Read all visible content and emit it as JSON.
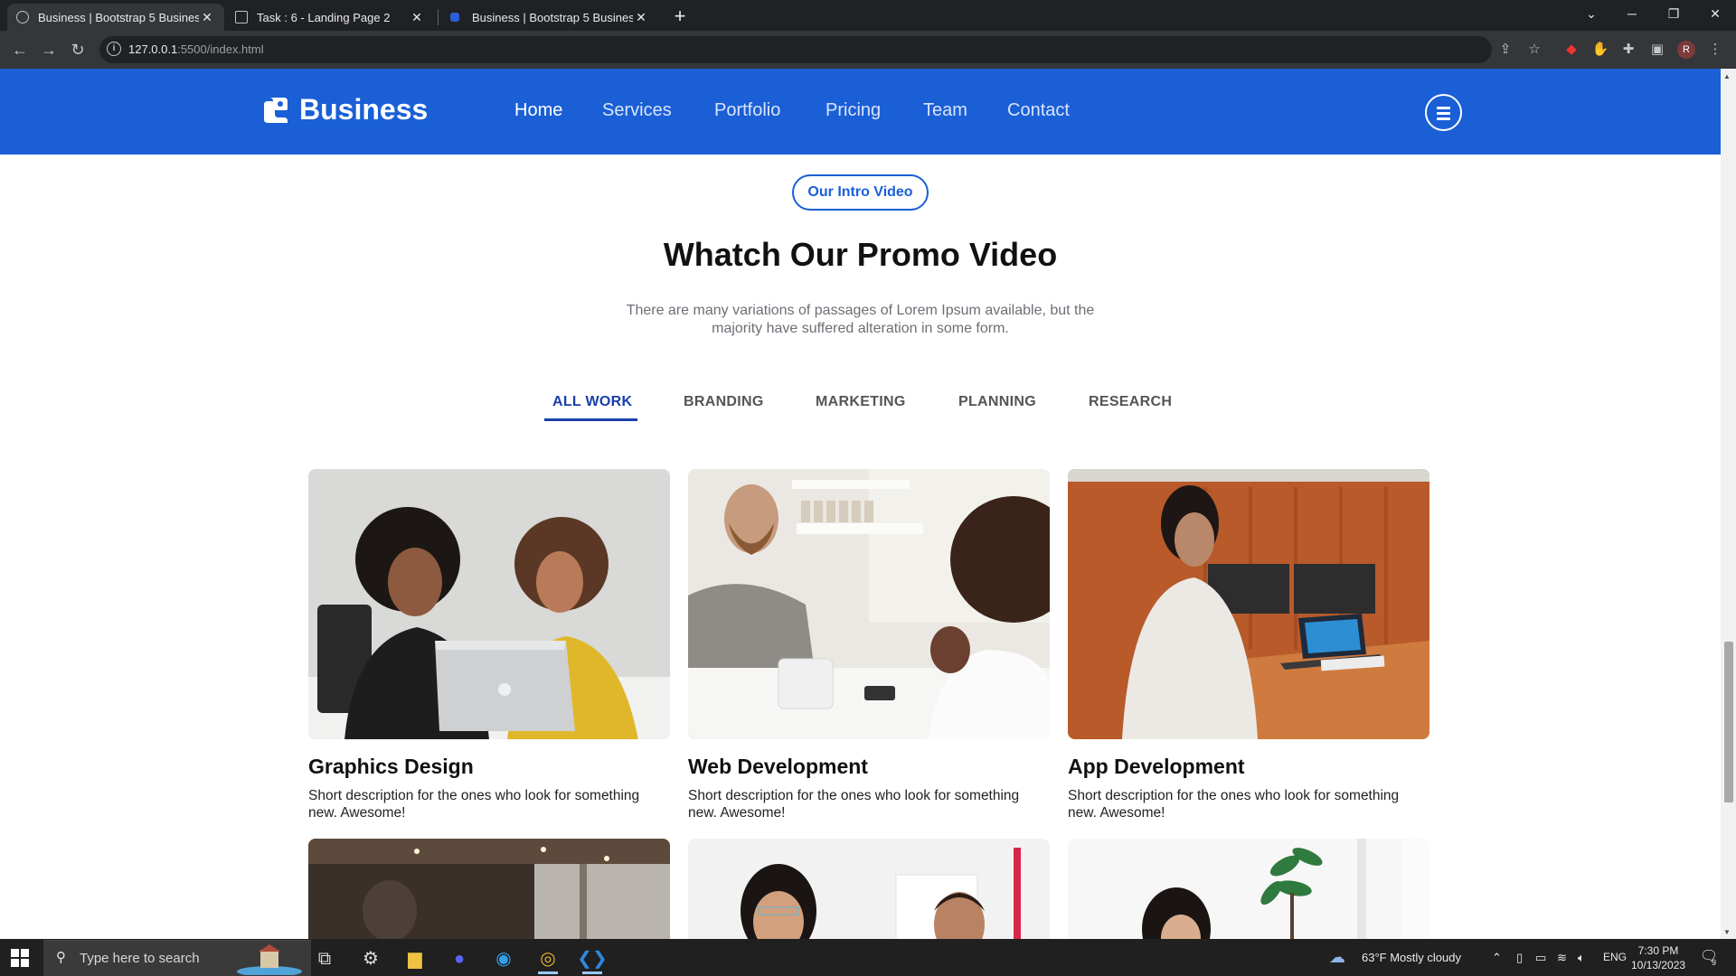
{
  "browser": {
    "tabs": [
      {
        "title": "Business | Bootstrap 5 Business T",
        "active": true
      },
      {
        "title": "Task : 6 - Landing Page 2",
        "active": false
      },
      {
        "title": "Business | Bootstrap 5 Business T",
        "active": false
      }
    ],
    "url_host": "127.0.0.1",
    "url_path": ":5500/index.html",
    "profile_initial": "R"
  },
  "site": {
    "brand": "Business",
    "nav": [
      "Home",
      "Services",
      "Portfolio",
      "Pricing",
      "Team",
      "Contact"
    ],
    "accent_color": "#1a5fd6"
  },
  "section": {
    "badge": "Our Intro Video",
    "heading": "Whatch Our Promo Video",
    "subtext": "There are many variations of passages of Lorem Ipsum available, but the majority have suffered alteration in some form."
  },
  "filters": {
    "items": [
      "ALL WORK",
      "BRANDING",
      "MARKETING",
      "PLANNING",
      "RESEARCH"
    ],
    "active": "ALL WORK"
  },
  "portfolio": [
    {
      "title": "Graphics Design",
      "desc": "Short description for the ones who look for something new. Awesome!"
    },
    {
      "title": "Web Development",
      "desc": "Short description for the ones who look for something new. Awesome!"
    },
    {
      "title": "App Development",
      "desc": "Short description for the ones who look for something new. Awesome!"
    }
  ],
  "taskbar": {
    "search_placeholder": "Type here to search",
    "weather": "63°F  Mostly cloudy",
    "language": "ENG",
    "time": "7:30 PM",
    "date": "10/13/2023",
    "notification_count": "9"
  }
}
